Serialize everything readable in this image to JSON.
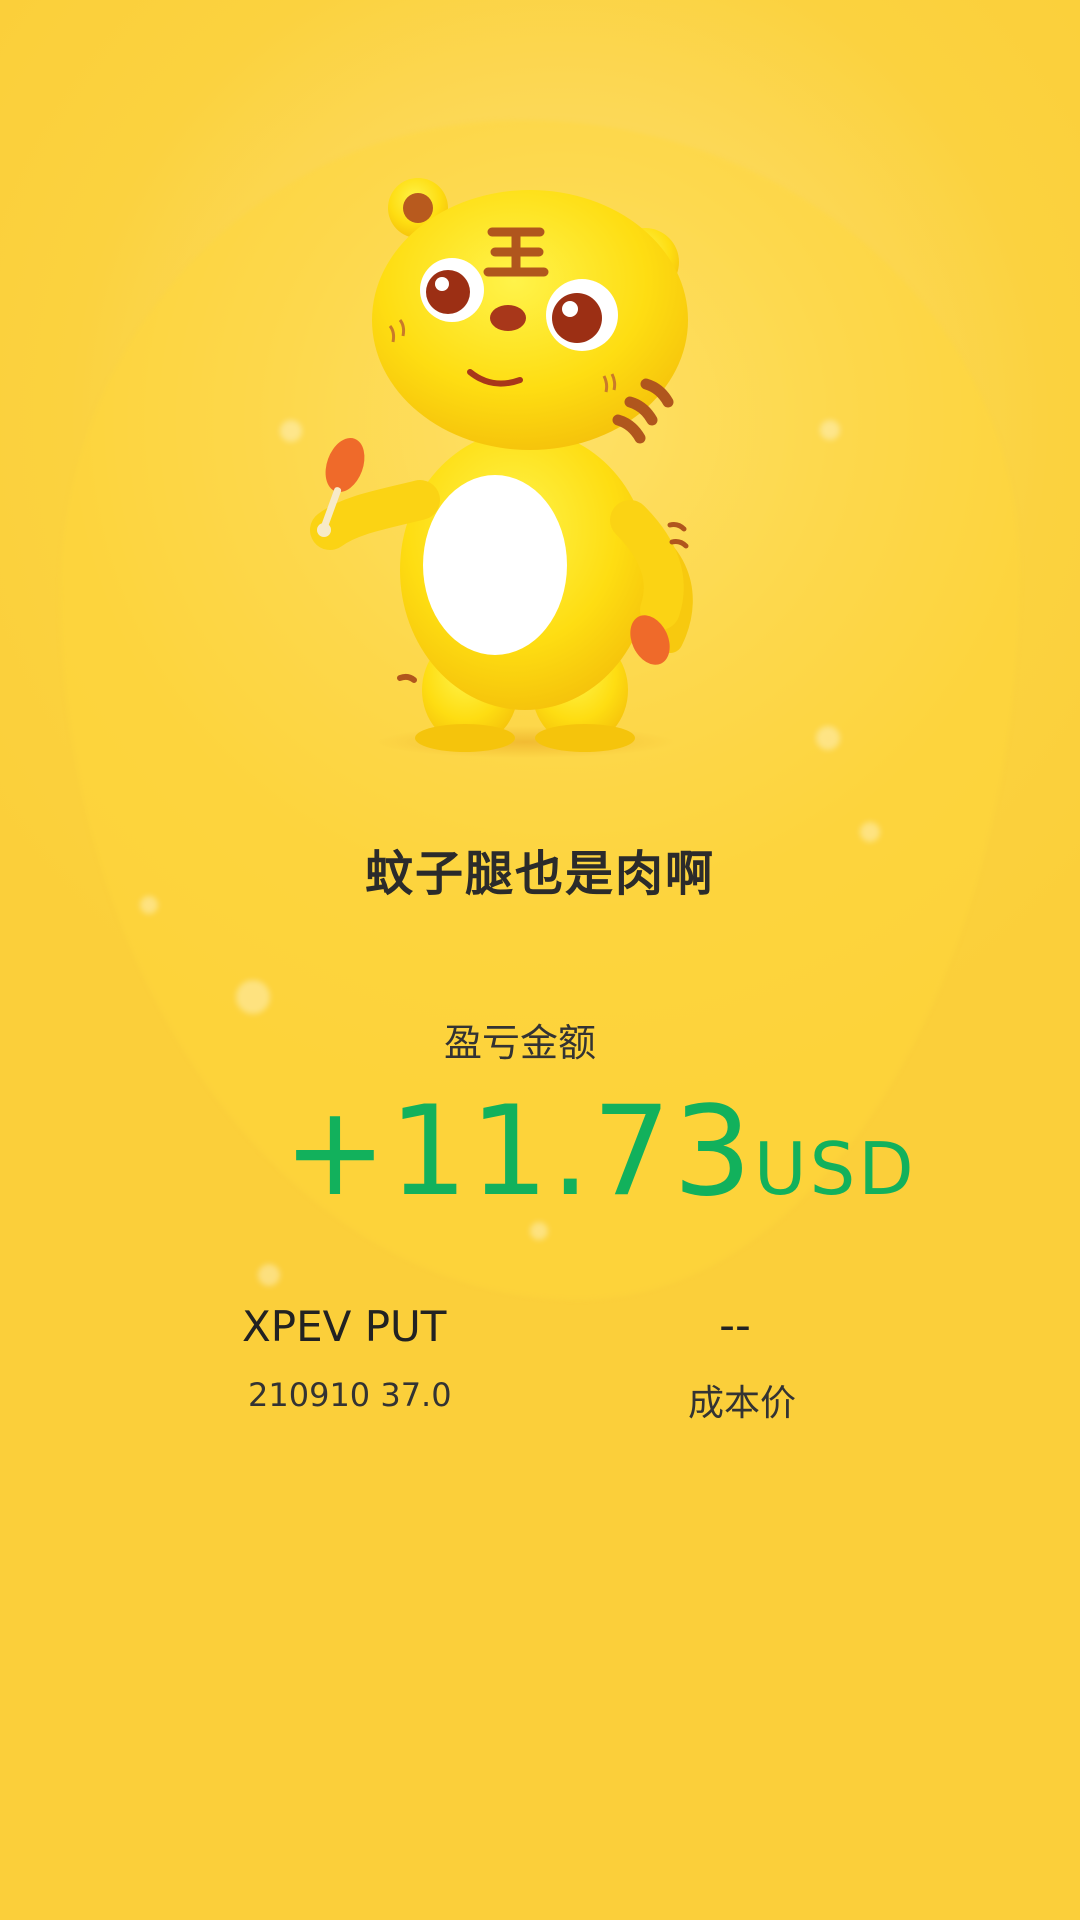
{
  "share_card": {
    "slogan": "蚊子腿也是肉啊",
    "pl_label": "盈亏金额",
    "pl_value": "+11.73",
    "pl_currency": "USD",
    "pl_color": "#12b15c",
    "symbol": "XPEV PUT",
    "contract": "210910 37.0",
    "cost_value": "--",
    "cost_label": "成本价",
    "mascot": "tiger-mascot-icon"
  }
}
